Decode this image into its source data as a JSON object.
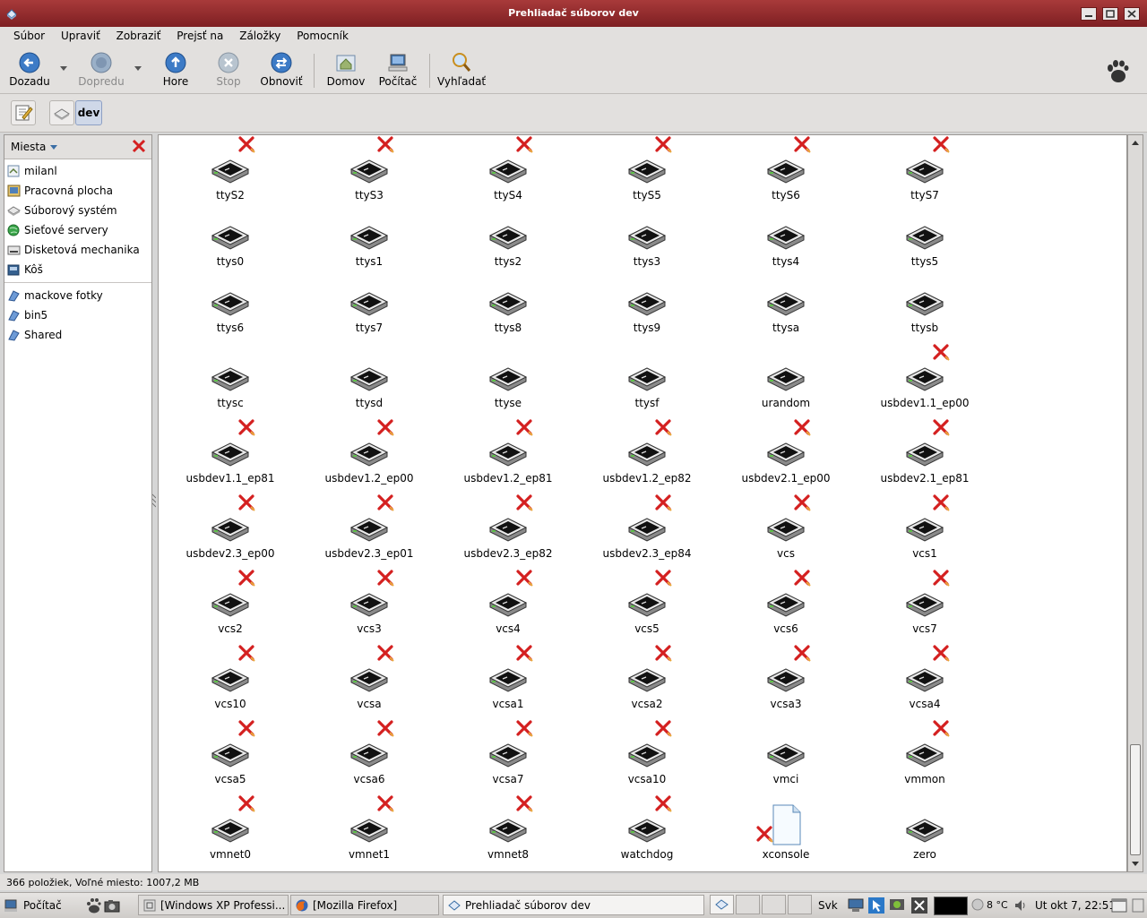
{
  "window": {
    "title": "Prehliadač súborov dev"
  },
  "menu": [
    "Súbor",
    "Upraviť",
    "Zobraziť",
    "Prejsť na",
    "Záložky",
    "Pomocník"
  ],
  "toolbar": {
    "back": "Dozadu",
    "forward": "Dopredu",
    "up": "Hore",
    "stop": "Stop",
    "reload": "Obnoviť",
    "home": "Domov",
    "computer": "Počítač",
    "search": "Vyhľadať"
  },
  "location": {
    "current": "dev"
  },
  "sidebar": {
    "header": "Miesta",
    "places": [
      "milanl",
      "Pracovná plocha",
      "Súborový systém",
      "Sieťové servery",
      "Disketová mechanika",
      "Kôš"
    ],
    "bookmarks": [
      "mackove fotky",
      "bin5",
      "Shared"
    ]
  },
  "files": {
    "names": [
      "ttyS2",
      "ttyS3",
      "ttyS4",
      "ttyS5",
      "ttyS6",
      "ttyS7",
      "ttys0",
      "ttys1",
      "ttys2",
      "ttys3",
      "ttys4",
      "ttys5",
      "ttys6",
      "ttys7",
      "ttys8",
      "ttys9",
      "ttysa",
      "ttysb",
      "ttysc",
      "ttysd",
      "ttyse",
      "ttysf",
      "urandom",
      "usbdev1.1_ep00",
      "usbdev1.1_ep81",
      "usbdev1.2_ep00",
      "usbdev1.2_ep81",
      "usbdev1.2_ep82",
      "usbdev2.1_ep00",
      "usbdev2.1_ep81",
      "usbdev2.3_ep00",
      "usbdev2.3_ep01",
      "usbdev2.3_ep82",
      "usbdev2.3_ep84",
      "vcs",
      "vcs1",
      "vcs2",
      "vcs3",
      "vcs4",
      "vcs5",
      "vcs6",
      "vcs7",
      "vcs10",
      "vcsa",
      "vcsa1",
      "vcsa2",
      "vcsa3",
      "vcsa4",
      "vcsa5",
      "vcsa6",
      "vcsa7",
      "vcsa10",
      "vmci",
      "vmmon",
      "vmnet0",
      "vmnet1",
      "vmnet8",
      "watchdog",
      "xconsole",
      "zero"
    ],
    "no_access": [
      1,
      1,
      1,
      1,
      1,
      1,
      0,
      0,
      0,
      0,
      0,
      0,
      0,
      0,
      0,
      0,
      0,
      0,
      0,
      0,
      0,
      0,
      0,
      1,
      1,
      1,
      1,
      1,
      1,
      1,
      1,
      1,
      1,
      1,
      1,
      1,
      1,
      1,
      1,
      1,
      1,
      1,
      1,
      1,
      1,
      1,
      1,
      1,
      1,
      1,
      1,
      1,
      0,
      1,
      1,
      1,
      1,
      1,
      1,
      0
    ],
    "kind": [
      "device",
      "device",
      "device",
      "device",
      "device",
      "device",
      "device",
      "device",
      "device",
      "device",
      "device",
      "device",
      "device",
      "device",
      "device",
      "device",
      "device",
      "device",
      "device",
      "device",
      "device",
      "device",
      "device",
      "device",
      "device",
      "device",
      "device",
      "device",
      "device",
      "device",
      "device",
      "device",
      "device",
      "device",
      "device",
      "device",
      "device",
      "device",
      "device",
      "device",
      "device",
      "device",
      "device",
      "device",
      "device",
      "device",
      "device",
      "device",
      "device",
      "device",
      "device",
      "device",
      "device",
      "device",
      "device",
      "device",
      "device",
      "device",
      "document",
      "device"
    ]
  },
  "status": {
    "text": "366 položiek, Voľné miesto: 1007,2 MB"
  },
  "taskbar": {
    "start": "Počítač",
    "tasks": [
      "[Windows XP Professi...",
      "[Mozilla Firefox]",
      "Prehliadač súborov dev"
    ],
    "keyboard": "Svk",
    "temperature": "8 °C",
    "clock": "Ut okt 7, 22:51"
  },
  "colors": {
    "titlebar": "#8e2a2c",
    "accent": "#3a6ea5",
    "error": "#d42020"
  }
}
